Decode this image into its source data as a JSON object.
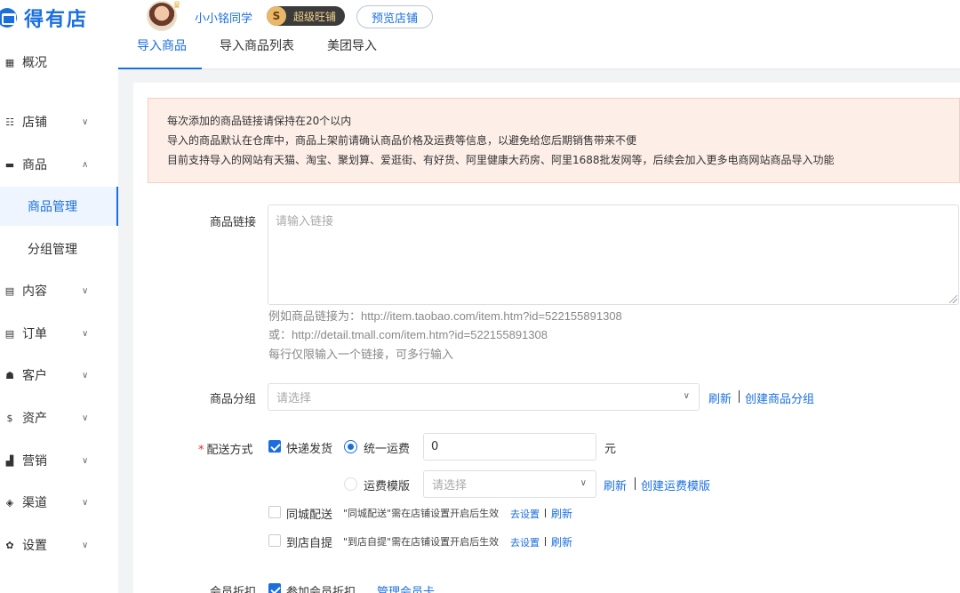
{
  "header": {
    "logo_text": "得有店",
    "username": "小小铭同学",
    "badge_letter": "S",
    "badge_label": "超级旺铺",
    "preview_label": "预览店铺"
  },
  "sidebar": {
    "items": [
      {
        "label": "概况",
        "icon": "grid-icon"
      },
      {
        "label": "店铺",
        "icon": "store-icon"
      },
      {
        "label": "商品",
        "icon": "goods-icon"
      },
      {
        "label": "商品管理"
      },
      {
        "label": "分组管理"
      },
      {
        "label": "内容",
        "icon": "content-icon"
      },
      {
        "label": "订单",
        "icon": "order-icon"
      },
      {
        "label": "客户",
        "icon": "customer-icon"
      },
      {
        "label": "资产",
        "icon": "asset-icon"
      },
      {
        "label": "营销",
        "icon": "marketing-icon"
      },
      {
        "label": "渠道",
        "icon": "channel-icon"
      },
      {
        "label": "设置",
        "icon": "settings-icon"
      }
    ]
  },
  "tabs": [
    "导入商品",
    "导入商品列表",
    "美团导入"
  ],
  "notice": [
    "每次添加的商品链接请保持在20个以内",
    "导入的商品默认在仓库中，商品上架前请确认商品价格及运费等信息，以避免给您后期销售带来不便",
    "目前支持导入的网站有天猫、淘宝、聚划算、爱逛街、有好货、阿里健康大药房、阿里1688批发网等，后续会加入更多电商网站商品导入功能"
  ],
  "form": {
    "link_label": "商品链接",
    "link_placeholder": "请输入链接",
    "hints": [
      "例如商品链接为：http://item.taobao.com/item.htm?id=522155891308",
      "或：http://detail.tmall.com/item.htm?id=522155891308",
      "每行仅限输入一个链接，可多行输入"
    ],
    "group_label": "商品分组",
    "group_placeholder": "请选择",
    "refresh": "刷新",
    "create_group": "创建商品分组",
    "shipping_label": "配送方式",
    "express": "快递发货",
    "unified_fee": "统一运费",
    "unified_fee_value": "0",
    "currency": "元",
    "fee_template": "运费模版",
    "template_placeholder": "请选择",
    "create_template": "创建运费模版",
    "city_delivery": "同城配送",
    "city_note": "\"同城配送\"需在店铺设置开启后生效",
    "pickup": "到店自提",
    "pickup_note": "\"到店自提\"需在店铺设置开启后生效",
    "go_settings": "去设置",
    "refresh_small": "刷新",
    "member_label": "会员折扣",
    "member_join": "参加会员折扣",
    "member_manage": "管理会员卡"
  }
}
